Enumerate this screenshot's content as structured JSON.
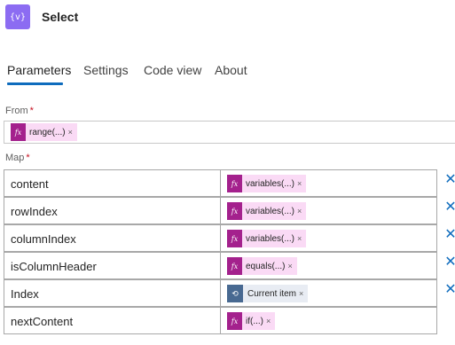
{
  "action": {
    "icon": "variable-braces-icon",
    "icon_glyph": "{v}",
    "title": "Select"
  },
  "tabs": [
    {
      "label": "Parameters",
      "active": true
    },
    {
      "label": "Settings",
      "active": false
    },
    {
      "label": "Code view",
      "active": false
    },
    {
      "label": "About",
      "active": false
    }
  ],
  "from": {
    "label": "From",
    "required_mark": "*",
    "token": {
      "icon": "fx-icon",
      "icon_glyph": "fx",
      "text": "range(...)",
      "remove": "×"
    }
  },
  "map": {
    "label": "Map",
    "required_mark": "*",
    "rows": [
      {
        "key": "content",
        "value": {
          "type": "expression",
          "icon_glyph": "fx",
          "text": "variables(...)",
          "remove": "×"
        }
      },
      {
        "key": "rowIndex",
        "value": {
          "type": "expression",
          "icon_glyph": "fx",
          "text": "variables(...)",
          "remove": "×"
        }
      },
      {
        "key": "columnIndex",
        "value": {
          "type": "expression",
          "icon_glyph": "fx",
          "text": "variables(...)",
          "remove": "×"
        }
      },
      {
        "key": "isColumnHeader",
        "value": {
          "type": "expression",
          "icon_glyph": "fx",
          "text": "equals(...)",
          "remove": "×"
        }
      },
      {
        "key": "Index",
        "value": {
          "type": "dynamic",
          "icon_glyph": "⟲",
          "text": "Current item",
          "remove": "×"
        }
      },
      {
        "key": "nextContent",
        "value": {
          "type": "expression",
          "icon_glyph": "fx",
          "text": "if(...)",
          "remove": "×"
        }
      }
    ],
    "delete_glyph": "✕"
  },
  "colors": {
    "accent": "#0f6cbd",
    "action_icon": "#8c6cf2",
    "expression": "#a4218d",
    "expression_bg": "#fadaf5",
    "dynamic": "#486991"
  }
}
